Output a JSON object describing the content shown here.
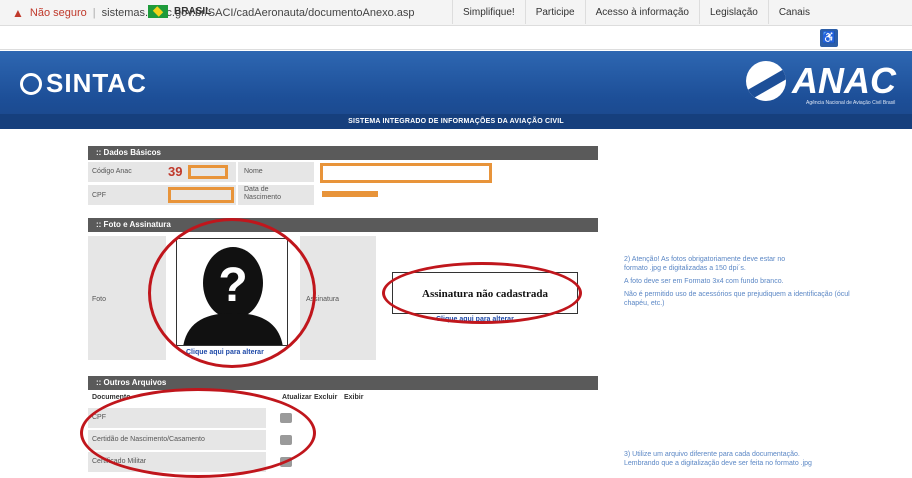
{
  "browser": {
    "security": "Não seguro",
    "url": "sistemas.anac.gov.br/SACI/cadAeronauta/documentoAnexo.asp"
  },
  "govbar": {
    "country": "BRASIL",
    "links": [
      "Simplifique!",
      "Participe",
      "Acesso à informação",
      "Legislação",
      "Canais"
    ]
  },
  "header": {
    "brand": "SINTAC",
    "logo": "ANAC",
    "logo_sub": "Agência Nacional de Aviação Civil Brasil",
    "subtitle": "SISTEMA INTEGRADO DE INFORMAÇÕES DA AVIAÇÃO CIVIL"
  },
  "dados": {
    "title": ":: Dados Básicos",
    "codigo_label": "Código Anac",
    "codigo_value": "39",
    "nome_label": "Nome",
    "cpf_label": "CPF",
    "nasc_label": "Data de Nascimento"
  },
  "foto": {
    "title": ":: Foto e Assinatura",
    "foto_label": "Foto",
    "assinatura_label": "Assinatura",
    "photo_link": "Clique aqui para alterar",
    "signature_text": "Assinatura não cadastrada",
    "signature_link": "Clique aqui para alterar"
  },
  "arquivos": {
    "title": ":: Outros Arquivos",
    "columns": [
      "Documento",
      "Atualizar",
      "Excluir",
      "Exibir"
    ],
    "rows": [
      "CPF",
      "Certidão de Nascimento/Casamento",
      "Certificado Militar"
    ]
  },
  "notes": {
    "note2_line1": "2) Atenção! As fotos obrigatoriamente deve estar no",
    "note2_line2": "formato .jpg e digitalizadas a 150 dpi´s.",
    "note2_line3": "A foto deve ser em Formato 3x4 com fundo branco.",
    "note2_line4": "Não é permitido uso de acessórios que prejudiquem a identificação (ócul",
    "note2_line5": "chapéu, etc.)",
    "note3_line1": "3) Utilize um arquivo diferente para cada documentação.",
    "note3_line2": "Lembrando que a digitalização deve ser feita no formato .jpg"
  },
  "colors": {
    "header_blue": "#1d4f98",
    "highlight_red": "#c0161c",
    "redact_orange": "#e8943a"
  }
}
